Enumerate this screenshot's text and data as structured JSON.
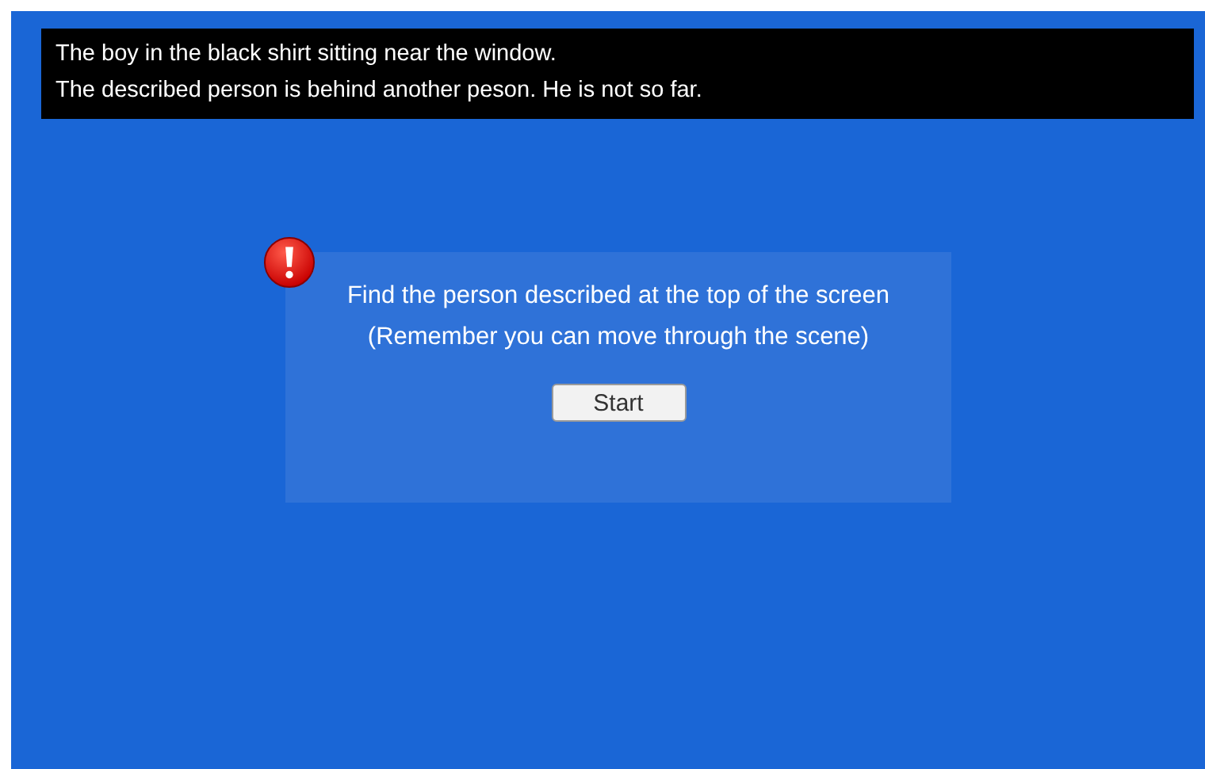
{
  "description": {
    "lines": [
      "The boy in the black shirt sitting near the window.",
      "The described person is behind another peson. He is not so far."
    ]
  },
  "dialog": {
    "alert": true,
    "lines": [
      "Find the person described at the top of the screen",
      "(Remember you can move through the scene)"
    ],
    "button": "Start"
  }
}
